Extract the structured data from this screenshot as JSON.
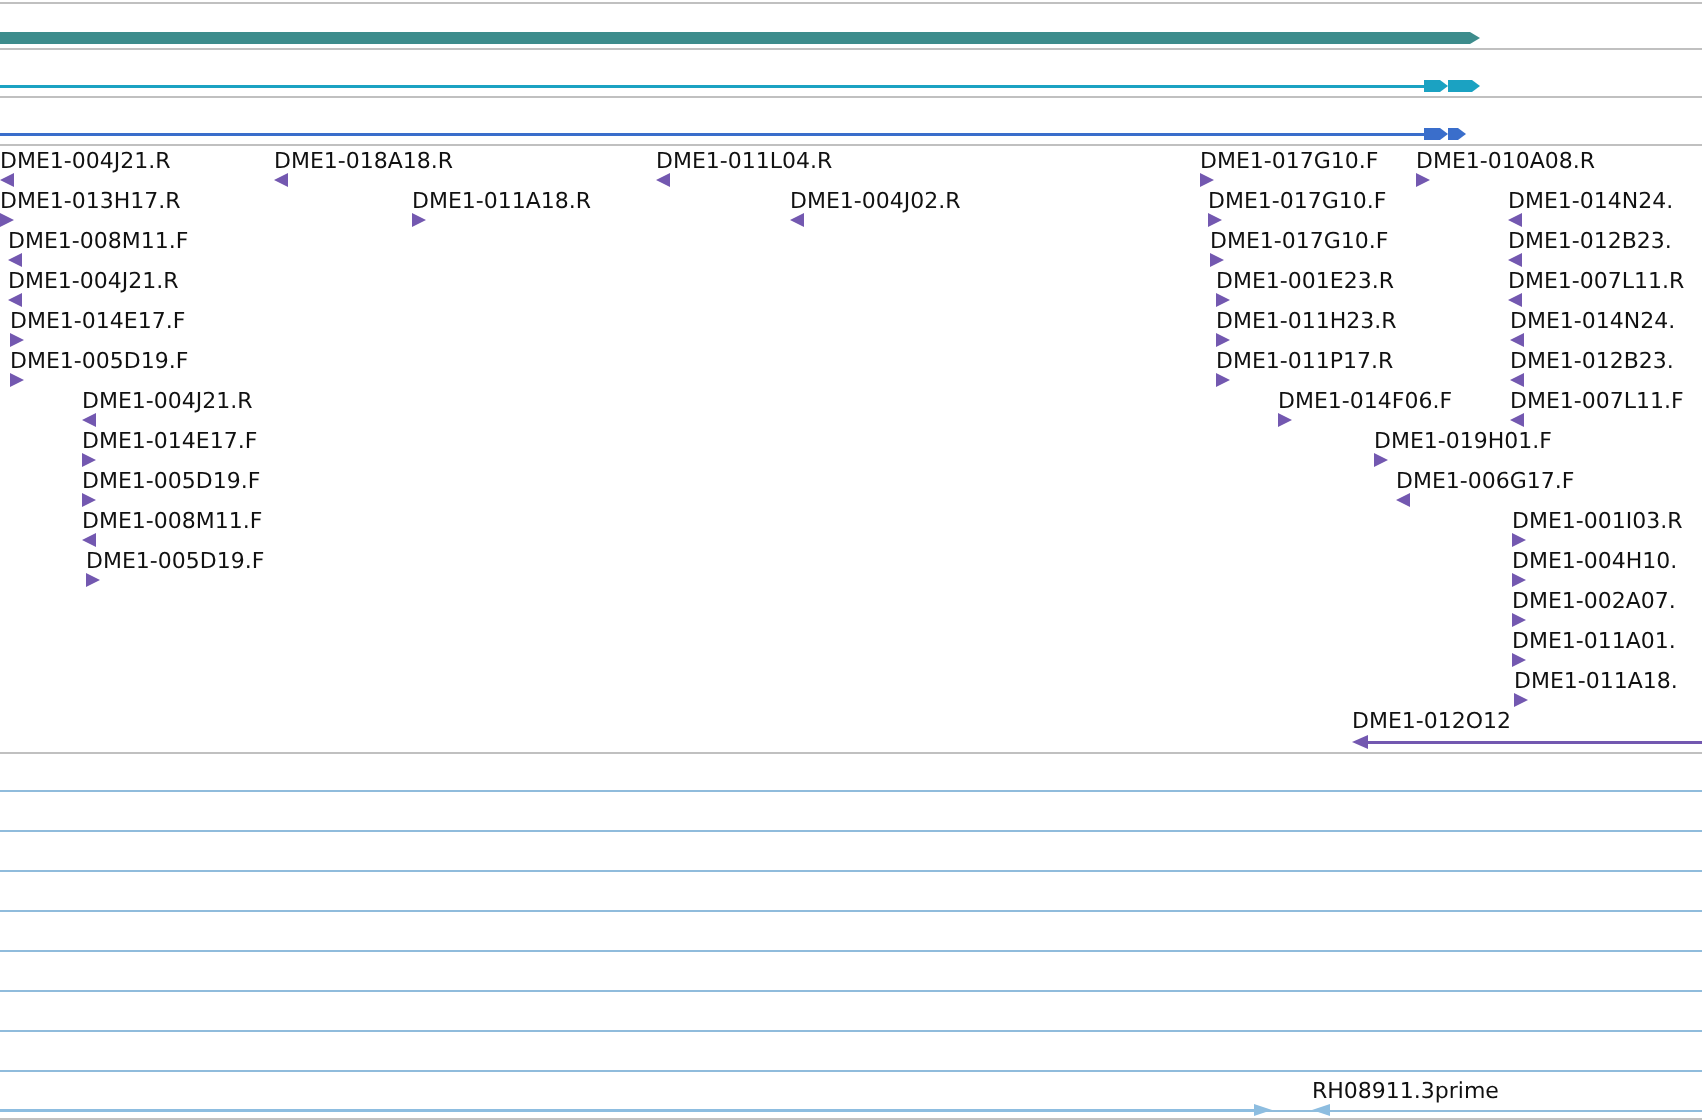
{
  "tracks": [
    {
      "kind": "bar",
      "color": "#3d8c8c"
    },
    {
      "kind": "segmented",
      "color": "#1ba2c2"
    },
    {
      "kind": "segmented",
      "color": "#3a6ecb"
    },
    {
      "kind": "clones",
      "features": [
        {
          "kind": "end",
          "label": "DME1-004J21.R",
          "reverse": true
        },
        {
          "kind": "end",
          "label": "DME1-018A18.R",
          "reverse": true
        },
        {
          "kind": "end",
          "label": "DME1-011L04.R",
          "reverse": true
        },
        {
          "kind": "end",
          "label": "DME1-017G10.F",
          "reverse": false
        },
        {
          "kind": "end",
          "label": "DME1-010A08.R",
          "reverse": false
        },
        {
          "kind": "end",
          "label": "DME1-013H17.R",
          "reverse": false
        },
        {
          "kind": "end",
          "label": "DME1-011A18.R",
          "reverse": false
        },
        {
          "kind": "end",
          "label": "DME1-004J02.R",
          "reverse": true
        },
        {
          "kind": "end",
          "label": "DME1-017G10.F",
          "reverse": false
        },
        {
          "kind": "end",
          "label": "DME1-014N24.",
          "reverse": true
        },
        {
          "kind": "end",
          "label": "DME1-008M11.F",
          "reverse": true
        },
        {
          "kind": "end",
          "label": "DME1-017G10.F",
          "reverse": false
        },
        {
          "kind": "end",
          "label": "DME1-012B23.",
          "reverse": true
        },
        {
          "kind": "end",
          "label": "DME1-004J21.R",
          "reverse": true
        },
        {
          "kind": "end",
          "label": "DME1-001E23.R",
          "reverse": false
        },
        {
          "kind": "end",
          "label": "DME1-007L11.R",
          "reverse": true
        },
        {
          "kind": "end",
          "label": "DME1-014E17.F",
          "reverse": false
        },
        {
          "kind": "end",
          "label": "DME1-011H23.R",
          "reverse": false
        },
        {
          "kind": "end",
          "label": "DME1-014N24.",
          "reverse": true
        },
        {
          "kind": "end",
          "label": "DME1-005D19.F",
          "reverse": false
        },
        {
          "kind": "end",
          "label": "DME1-011P17.R",
          "reverse": false
        },
        {
          "kind": "end",
          "label": "DME1-012B23.",
          "reverse": true
        },
        {
          "kind": "end",
          "label": "DME1-004J21.R",
          "reverse": true
        },
        {
          "kind": "end",
          "label": "DME1-014F06.F",
          "reverse": false
        },
        {
          "kind": "end",
          "label": "DME1-007L11.F",
          "reverse": true
        },
        {
          "kind": "end",
          "label": "DME1-014E17.F",
          "reverse": false
        },
        {
          "kind": "end",
          "label": "DME1-019H01.F",
          "reverse": false
        },
        {
          "kind": "end",
          "label": "DME1-005D19.F",
          "reverse": false
        },
        {
          "kind": "end",
          "label": "DME1-006G17.F",
          "reverse": true
        },
        {
          "kind": "end",
          "label": "DME1-008M11.F",
          "reverse": true
        },
        {
          "kind": "end",
          "label": "DME1-001I03.R",
          "reverse": false
        },
        {
          "kind": "end",
          "label": "DME1-005D19.F",
          "reverse": false
        },
        {
          "kind": "end",
          "label": "DME1-004H10.",
          "reverse": false
        },
        {
          "kind": "end",
          "label": "DME1-002A07.",
          "reverse": false
        },
        {
          "kind": "end",
          "label": "DME1-011A01.",
          "reverse": false
        },
        {
          "kind": "end",
          "label": "DME1-011A18.",
          "reverse": false
        },
        {
          "kind": "span",
          "label": "DME1-012O12",
          "reverse": true
        }
      ]
    },
    {
      "kind": "est",
      "features": [
        {
          "kind": "pair",
          "label": "RH08911.3prime",
          "color": "#8dbde0"
        }
      ]
    }
  ]
}
